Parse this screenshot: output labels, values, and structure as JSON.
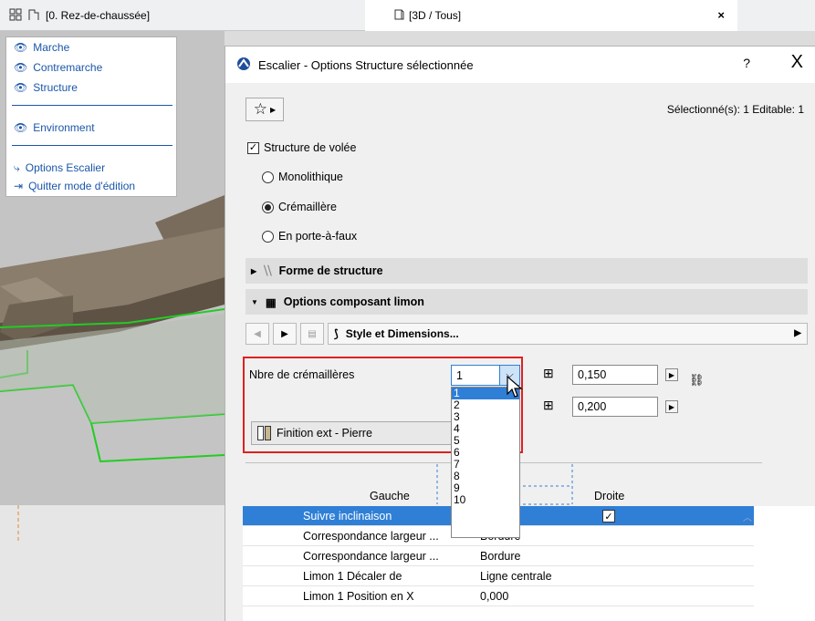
{
  "tabs": {
    "floorplan": "[0. Rez-de-chaussée]",
    "view3d": "[3D / Tous]",
    "close": "×"
  },
  "floatmenu": {
    "items": [
      "Marche",
      "Contremarche",
      "Structure"
    ],
    "environment": "Environment",
    "options": "Options Escalier",
    "quit": "Quitter mode d'édition"
  },
  "dialog": {
    "title": "Escalier - Options Structure sélectionnée",
    "help": "?",
    "close": "X",
    "selection_info": "Sélectionné(s): 1 Editable: 1",
    "structure_checkbox": "Structure de volée",
    "radios": [
      "Monolithique",
      "Crémaillère",
      "En porte-à-faux"
    ],
    "selected_radio": "Crémaillère",
    "sections": {
      "forme": "Forme de structure",
      "options": "Options composant limon"
    },
    "style_dropdown": "Style et Dimensions...",
    "nbre_label": "Nbre de crémaillères",
    "nbre_value": "1",
    "dropdown_options": [
      "1",
      "2",
      "3",
      "4",
      "5",
      "6",
      "7",
      "8",
      "9",
      "10"
    ],
    "width_value": "0,150",
    "height_value": "0,200",
    "finish_button": "Finition ext - Pierre",
    "table_headers": {
      "left": "Gauche",
      "right": "Droite"
    },
    "rows": [
      {
        "name": "Suivre inclinaison",
        "value": ""
      },
      {
        "name": "Correspondance largeur ...",
        "value": "Bordure"
      },
      {
        "name": "Correspondance largeur ...",
        "value": "Bordure"
      },
      {
        "name": "Limon 1 Décaler de",
        "value": "Ligne centrale"
      },
      {
        "name": "Limon 1 Position en X",
        "value": "0,000"
      }
    ]
  },
  "colors": {
    "accent": "#2f7fd6",
    "highlight_box": "#e02020",
    "menu_text": "#1a56a8"
  }
}
